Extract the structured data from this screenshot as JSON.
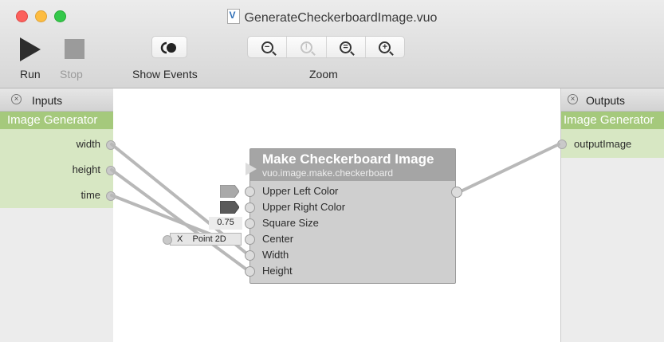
{
  "window": {
    "title": "GenerateCheckerboardImage.vuo"
  },
  "toolbar": {
    "run_label": "Run",
    "stop_label": "Stop",
    "show_events_label": "Show Events",
    "zoom_label": "Zoom"
  },
  "inputs_panel": {
    "header": "Inputs",
    "group_title": "Image Generator",
    "ports": [
      "width",
      "height",
      "time"
    ]
  },
  "outputs_panel": {
    "header": "Outputs",
    "group_title": "Image Generator",
    "ports": [
      "outputImage"
    ]
  },
  "node": {
    "title": "Make Checkerboard Image",
    "class_name": "vuo.image.make.checkerboard",
    "ports": [
      "Upper Left Color",
      "Upper Right Color",
      "Square Size",
      "Center",
      "Width",
      "Height"
    ],
    "square_size_constant": "0.75",
    "center_constant": "X    Point 2D",
    "upper_left_color": "#a9a9a9",
    "upper_right_color": "#5a5a5a"
  },
  "colors": {
    "group_header": "#a5c97c",
    "group_body": "#d7e7c3",
    "node_header": "#a5a5a5",
    "cable": "#b8b8b8"
  }
}
